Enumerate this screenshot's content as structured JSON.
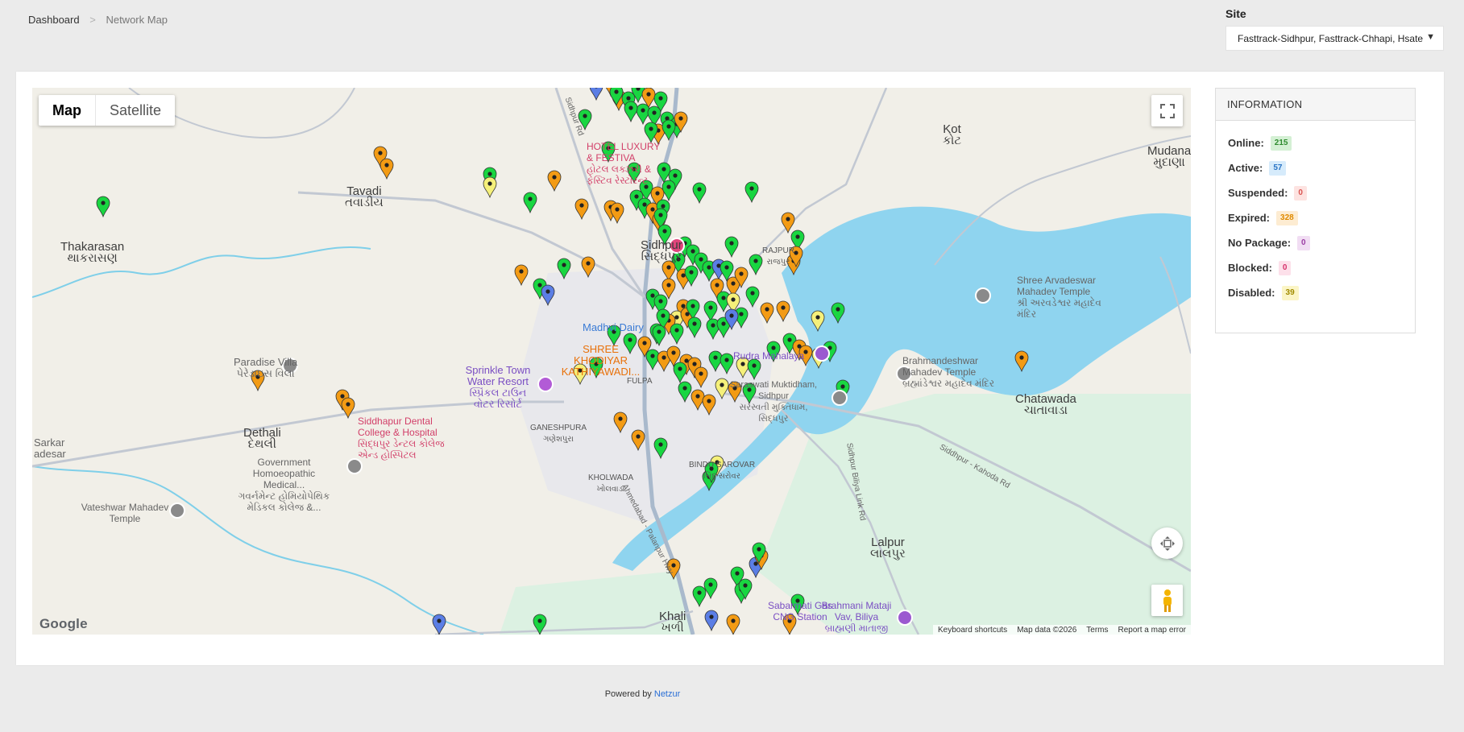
{
  "breadcrumb": {
    "home": "Dashboard",
    "separator": ">",
    "current": "Network Map"
  },
  "site": {
    "label": "Site",
    "selected": "Fasttrack-Sidhpur, Fasttrack-Chhapi, Hsate",
    "caret_icon": "chevron-down-icon"
  },
  "map": {
    "type_controls": {
      "map": "Map",
      "satellite": "Satellite",
      "active": "Map"
    },
    "fullscreen_icon": "fullscreen-icon",
    "camera_icon": "camera-move-icon",
    "pegman_icon": "pegman-icon",
    "logo": "Google",
    "attribution": {
      "shortcuts": "Keyboard shortcuts",
      "data": "Map data ©2026",
      "terms": "Terms",
      "report": "Report a map error"
    },
    "labels": {
      "kot": "Kot",
      "kot_gu": "કોટ",
      "mudana": "Mudana",
      "mudana_gu": "મુદાણા",
      "tavadi": "Tavadi",
      "tavadi_gu": "તવાડીય",
      "thakarasan": "Thakarasan",
      "thakarasan_gu": "થાકરાસણ",
      "hotel": "HOTEL LUXURY & FESTIVA",
      "hotel_gu": "હોટલ લક્ઝરી & ફેસ્ટિવ રેસ્ટોરન્ટ",
      "sidhpur": "Sidhpur",
      "sidhpur_gu": "સિદ્ધપુર",
      "rajpur": "RAJPUR",
      "rajpur_gu": "રાજપુર",
      "arvadeswar": "Shree Arvadeswar Mahadev Temple",
      "arvadeswar_gu": "શ્રી અરવડેશ્વર મહાદેવ મંદિર",
      "madhvi": "Madhvi Dairy",
      "khodiyar": "SHREE KHODIYAR KATHIYAWADI...",
      "sprinkle": "Sprinkle Town Water Resort",
      "sprinkle_gu": "સ્પ્રિંકલ ટાઉન વોટર રિસોર્ટ",
      "paradise": "Paradise Villa",
      "paradise_gu": "પેરેડાઇસ વિલા",
      "rudra": "Rudra Mahalaya",
      "brahmandeshwar": "Brahmandeshwar Mahadev Temple",
      "brahmandeshwar_gu": "બ્રહ્માંડેશ્વર મહાદેવ મંદિર",
      "saraswati": "Saraswati Muktidham, Sidhpur",
      "saraswati_gu": "સરસ્વતી મુક્તિધામ, સિદ્ધપુર",
      "chatawada": "Chatawada",
      "chatawada_gu": "ચાતાવાડા",
      "dethali": "Dethali",
      "dethali_gu": "દેથલી",
      "sarkar": "Sarkar",
      "adesar": "adesar",
      "dental": "Siddhapur Dental College & Hospital",
      "dental_gu": "સિદ્ધપુર ડેન્ટલ કોલેજ એન્ડ હોસ્પિટલ",
      "ganeshpura": "GANESHPURA",
      "ganeshpura_gu": "ગણેશપુરા",
      "fulpada": "FULPA",
      "homoeo": "Government Homoeopathic Medical...",
      "homoeo_gu": "ગવર્નમેન્ટ હોમિયોપેથિક મેડિકલ કોલેજ &...",
      "bindu": "BINDU SAROVAR",
      "bindu_gu": "બિંદુ સરોવર",
      "kholwada": "KHOLWADA",
      "kholwada_gu": "ખોલવાડા",
      "vateshwar": "Vateshwar Mahadev Temple",
      "ahmedabad_rd": "Ahmedabad - Palanpur Hwy",
      "sidhpur_rd": "Sidhpur Rd",
      "kahoda_rd": "Siddhpur - Kahoda Rd",
      "biliya_rd": "Sidhpur Biliya Link Rd",
      "lalpur": "Lalpur",
      "lalpur_gu": "લાલપુર",
      "khali": "Khali",
      "khali_gu": "ખળી",
      "sabarmati": "Sabarmati Gas CNG Station",
      "brahmani": "Brahmani Mataji Vav, Biliya",
      "brahmani_gu": "બ્રાહ્મણી માતાજી"
    }
  },
  "info": {
    "title": "INFORMATION",
    "rows": [
      {
        "label": "Online:",
        "value": "215",
        "bg": "#d4f0d4",
        "fg": "#2e8b2e"
      },
      {
        "label": "Active:",
        "value": "57",
        "bg": "#d6ebfb",
        "fg": "#2a74c5"
      },
      {
        "label": "Suspended:",
        "value": "0",
        "bg": "#fde3e1",
        "fg": "#d9534f"
      },
      {
        "label": "Expired:",
        "value": "328",
        "bg": "#fdecd2",
        "fg": "#e08a00"
      },
      {
        "label": "No Package:",
        "value": "0",
        "bg": "#f1ddf3",
        "fg": "#9b3ca3"
      },
      {
        "label": "Blocked:",
        "value": "0",
        "bg": "#fde0ea",
        "fg": "#d6336c"
      },
      {
        "label": "Disabled:",
        "value": "39",
        "bg": "#fbf5c6",
        "fg": "#a08b00"
      }
    ]
  },
  "footer": {
    "prefix": "Powered by",
    "link": "Netzur"
  },
  "colors": {
    "online_marker": "#19d641",
    "active_marker": "#5b7ee5",
    "expired_marker": "#f39b14",
    "disabled_marker": "#f5f07a",
    "water": "#8fd4ef",
    "green_area": "#dff3e4"
  }
}
